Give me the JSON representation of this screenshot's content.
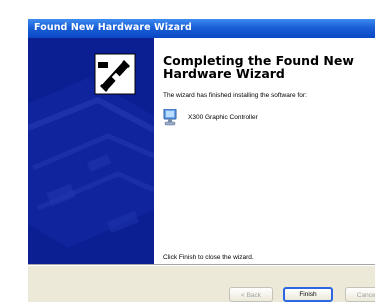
{
  "window": {
    "title": "Found New Hardware Wizard"
  },
  "content": {
    "heading": "Completing the Found New Hardware Wizard",
    "intro": "The wizard has finished installing the software for:",
    "device_name": "X300 Graphic Controller",
    "finish_instruction": "Click Finish to close the wizard."
  },
  "buttons": {
    "back_label": "< Back",
    "finish_label": "Finish",
    "cancel_label": "Cancel"
  },
  "icons": {
    "wizard": "hardware-card-icon",
    "device": "monitor-icon"
  },
  "colors": {
    "titlebar": "#1a5fd6",
    "sidebar": "#0b1e92",
    "footer": "#ece9d8"
  }
}
